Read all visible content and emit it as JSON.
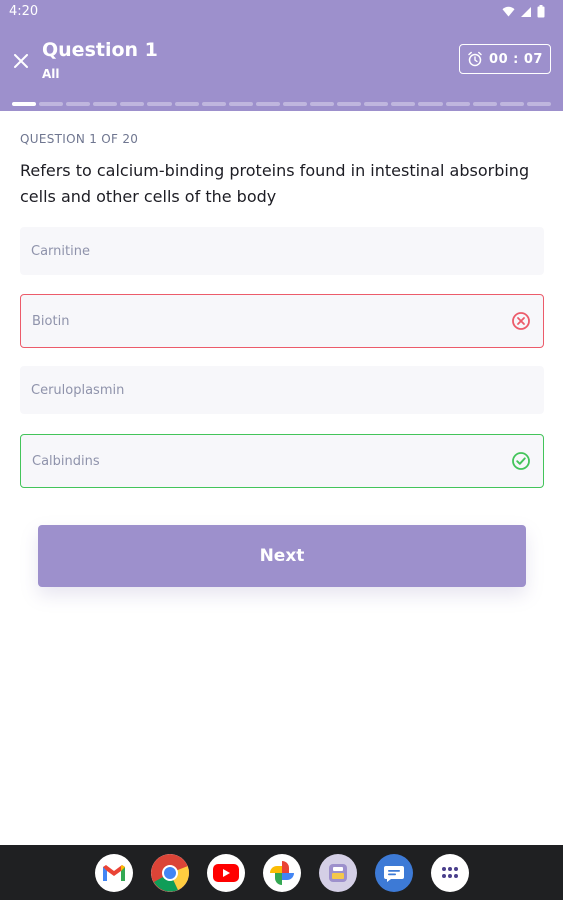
{
  "status_bar": {
    "time": "4:20"
  },
  "header": {
    "title": "Question 1",
    "subtitle": "All",
    "timer": "00 : 07",
    "accent_color": "#9d90cc",
    "progress": {
      "current": 1,
      "total": 20
    }
  },
  "question": {
    "counter": "QUESTION 1 OF 20",
    "text": "Refers to calcium-binding proteins found in intestinal absorbing cells and other cells of the body"
  },
  "options": [
    {
      "label": "Carnitine",
      "state": "neutral"
    },
    {
      "label": "Biotin",
      "state": "wrong",
      "icon": "x-circle-icon",
      "color": "#ec5b6a"
    },
    {
      "label": "Ceruloplasmin",
      "state": "neutral"
    },
    {
      "label": "Calbindins",
      "state": "correct",
      "icon": "check-circle-icon",
      "color": "#43c45a"
    }
  ],
  "actions": {
    "next_label": "Next"
  },
  "dock": {
    "apps": [
      "gmail-icon",
      "chrome-icon",
      "youtube-icon",
      "photos-icon",
      "app-icon",
      "messages-icon",
      "app-drawer-icon"
    ]
  }
}
